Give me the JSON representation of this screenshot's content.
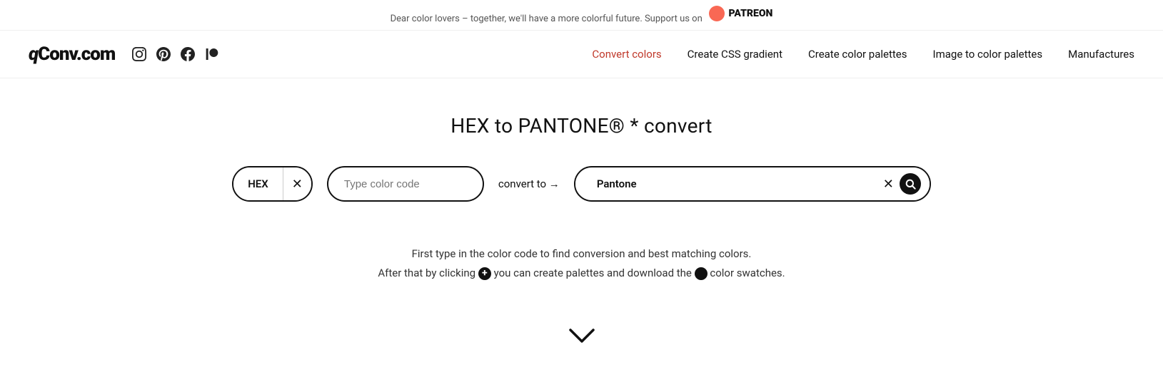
{
  "banner": {
    "text": "Dear color lovers – together, we'll have a more colorful future. Support us on",
    "patreon_label": "PATREON"
  },
  "header": {
    "logo_q": "q",
    "logo_rest": "Conv.com",
    "social_icons": [
      "instagram-icon",
      "pinterest-icon",
      "facebook-icon",
      "patreon-icon"
    ],
    "nav": [
      {
        "label": "Convert colors",
        "active": true
      },
      {
        "label": "Create CSS gradient",
        "active": false
      },
      {
        "label": "Create color palettes",
        "active": false
      },
      {
        "label": "Image to color palettes",
        "active": false
      },
      {
        "label": "Manufactures",
        "active": false
      }
    ]
  },
  "main": {
    "title": "HEX to PANTONE® * convert",
    "input_label": "HEX",
    "input_placeholder": "Type color code",
    "convert_to": "convert to →",
    "output_label": "Pantone",
    "helper_line1": "First type in the color code to find conversion and best matching colors.",
    "helper_line2_start": "After that by clicking",
    "helper_line2_end": "you can create palettes and download the",
    "helper_line2_last": "color swatches."
  }
}
